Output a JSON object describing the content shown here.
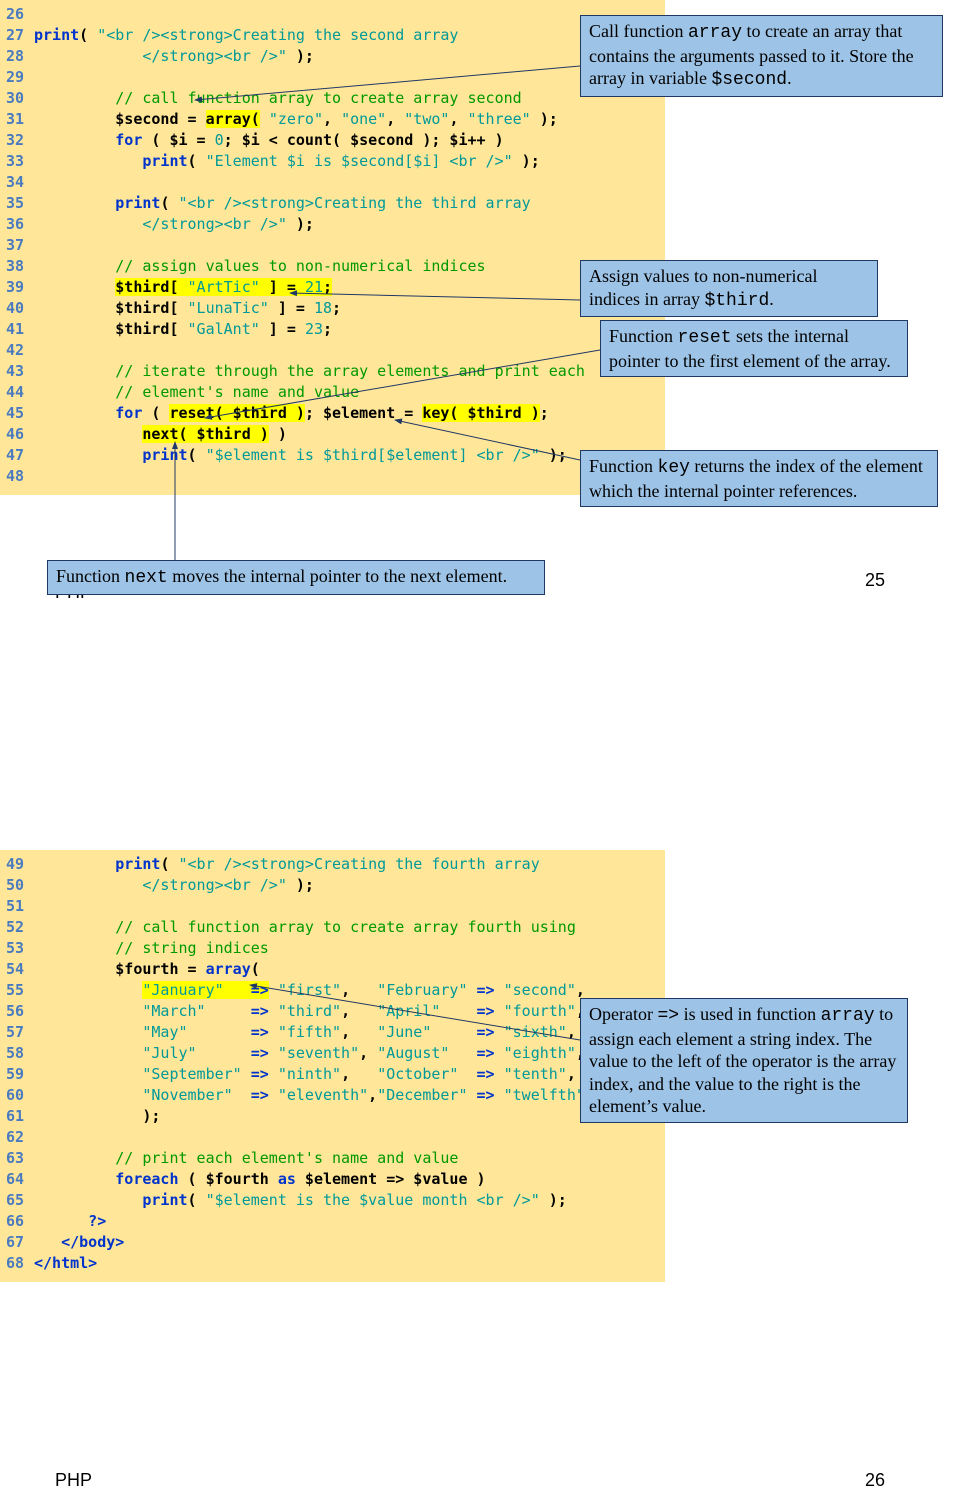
{
  "slide1": {
    "code": {
      "lines": [
        {
          "num": "26",
          "txt": ""
        },
        {
          "num": "27",
          "txt": "         print( \"<br /><strong>Creating the second array ",
          "cls": "mix27"
        },
        {
          "num": "28",
          "txt": "            </strong><br />\" );",
          "cls": "mix28"
        },
        {
          "num": "29",
          "txt": ""
        },
        {
          "num": "30",
          "txt": "         // call function array to create array second",
          "cls": "com"
        },
        {
          "num": "31",
          "txt": "         $second = array( \"zero\", \"one\", \"two\", \"three\" );",
          "cls": "mix31"
        },
        {
          "num": "32",
          "txt": "         for ( $i = 0; $i < count( $second ); $i++ )",
          "cls": "mix32"
        },
        {
          "num": "33",
          "txt": "            print( \"Element $i is $second[$i] <br />\" );",
          "cls": "mix33"
        },
        {
          "num": "34",
          "txt": ""
        },
        {
          "num": "35",
          "txt": "         print( \"<br /><strong>Creating the third array ",
          "cls": "mix35"
        },
        {
          "num": "36",
          "txt": "            </strong><br />\" );",
          "cls": "mix36"
        },
        {
          "num": "37",
          "txt": ""
        },
        {
          "num": "38",
          "txt": "         // assign values to non-numerical indices",
          "cls": "com"
        },
        {
          "num": "39",
          "txt": "         $third[ \"ArtTic\" ] = 21;",
          "cls": "mix39"
        },
        {
          "num": "40",
          "txt": "         $third[ \"LunaTic\" ] = 18;",
          "cls": "mix40"
        },
        {
          "num": "41",
          "txt": "         $third[ \"GalAnt\" ] = 23;",
          "cls": "mix41"
        },
        {
          "num": "42",
          "txt": ""
        },
        {
          "num": "43",
          "txt": "         // iterate through the array elements and print each",
          "cls": "com"
        },
        {
          "num": "44",
          "txt": "         // element's name and value",
          "cls": "com"
        },
        {
          "num": "45",
          "txt": "         for ( reset( $third ); $element = key( $third ); ",
          "cls": "mix45"
        },
        {
          "num": "46",
          "txt": "            next( $third ) )            ",
          "cls": "mix46"
        },
        {
          "num": "47",
          "txt": "            print( \"$element is $third[$element] <br />\" );",
          "cls": "mix47"
        },
        {
          "num": "48",
          "txt": ""
        }
      ]
    },
    "callouts": {
      "c1_pre": "Call function ",
      "c1_mono1": "array",
      "c1_mid": " to create an array that contains the arguments passed to it. Store the array in variable ",
      "c1_mono2": "$second",
      "c1_suf": ".",
      "c2_pre": "Assign values to non-numerical indices in array ",
      "c2_mono": "$third",
      "c2_suf": ".",
      "c3_pre": "Function ",
      "c3_mono": "reset",
      "c3_suf": " sets the internal pointer to the first element of the array.",
      "c4_pre": "Function ",
      "c4_mono": "key",
      "c4_suf": " returns the index of the element which the internal pointer references.",
      "c5_pre": "Function ",
      "c5_mono": "next",
      "c5_suf": " moves the internal pointer to the next element."
    },
    "footer_label": "PHP",
    "footer_num": "25"
  },
  "slide2": {
    "code": {
      "lines": [
        {
          "num": "49",
          "txt": "         print( \"<br /><strong>Creating the fourth array",
          "cls": "mix49"
        },
        {
          "num": "50",
          "txt": "            </strong><br />\" );",
          "cls": "mix50"
        },
        {
          "num": "51",
          "txt": ""
        },
        {
          "num": "52",
          "txt": "         // call function array to create array fourth using",
          "cls": "com"
        },
        {
          "num": "53",
          "txt": "         // string indices",
          "cls": "com"
        },
        {
          "num": "54",
          "txt": "         $fourth = array(",
          "cls": "mix54"
        },
        {
          "num": "55",
          "txt": "            \"January\"   => \"first\",   \"February\" => \"second\",",
          "cls": "mix55"
        },
        {
          "num": "56",
          "txt": "            \"March\"     => \"third\",   \"April\"    => \"fourth\",",
          "cls": "mix56"
        },
        {
          "num": "57",
          "txt": "            \"May\"       => \"fifth\",   \"June\"     => \"sixth\",",
          "cls": "mix57"
        },
        {
          "num": "58",
          "txt": "            \"July\"      => \"seventh\", \"August\"   => \"eighth\",",
          "cls": "mix58"
        },
        {
          "num": "59",
          "txt": "            \"September\" => \"ninth\",   \"October\"  => \"tenth\",",
          "cls": "mix59"
        },
        {
          "num": "60",
          "txt": "            \"November\"  => \"eleventh\",\"December\" => \"twelfth\"",
          "cls": "mix60"
        },
        {
          "num": "61",
          "txt": "            );",
          "cls": "n"
        },
        {
          "num": "62",
          "txt": ""
        },
        {
          "num": "63",
          "txt": "         // print each element's name and value",
          "cls": "com"
        },
        {
          "num": "64",
          "txt": "         foreach ( $fourth as $element => $value ) ",
          "cls": "mix64"
        },
        {
          "num": "65",
          "txt": "            print( \"$element is the $value month <br />\" );",
          "cls": "mix65"
        },
        {
          "num": "66",
          "txt": "      ?>",
          "cls": "kw"
        },
        {
          "num": "67",
          "txt": "   </body>",
          "cls": "kw"
        },
        {
          "num": "68",
          "txt": "</html>",
          "cls": "kw"
        }
      ]
    },
    "callouts": {
      "c6_pre": "Operator ",
      "c6_mono": "=>",
      "c6_mid": " is used in function ",
      "c6_mono2": "array",
      "c6_suf": " to assign each element a string index. The value to the left of the operator is the array index, and the value to the right is the element’s value."
    },
    "footer_label": "PHP",
    "footer_num": "26"
  }
}
